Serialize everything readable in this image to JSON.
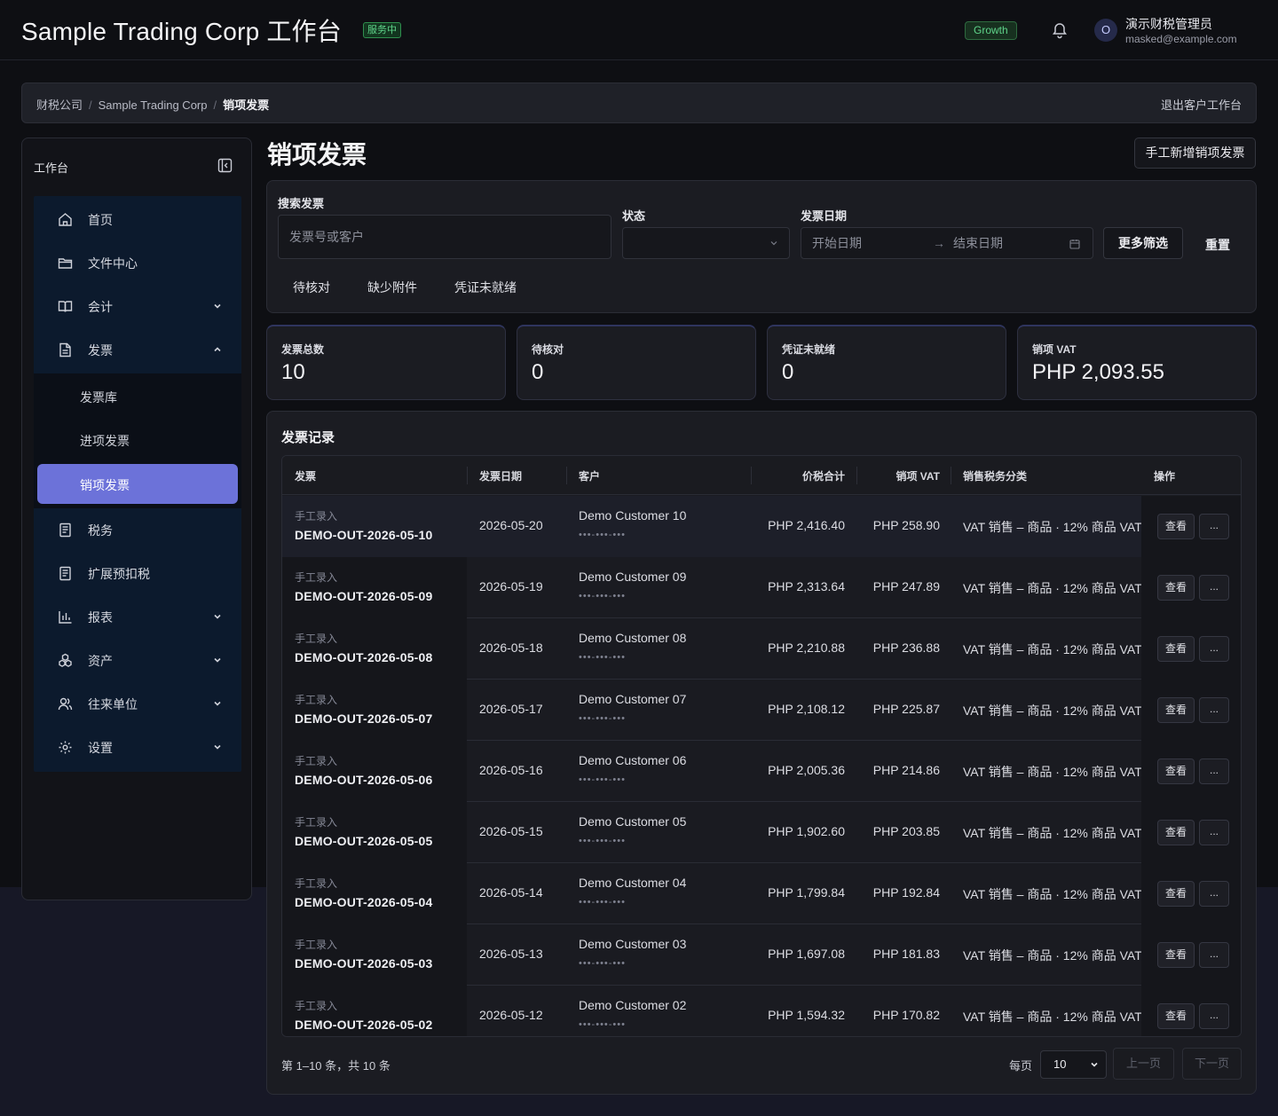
{
  "header": {
    "app_title": "Sample Trading Corp 工作台",
    "service_status": "服务中",
    "plan": "Growth",
    "user_initial": "O",
    "user_name": "演示财税管理员",
    "user_email": "masked@example.com"
  },
  "breadcrumb": {
    "items": [
      "财税公司",
      "Sample Trading Corp",
      "销项发票"
    ],
    "exit_label": "退出客户工作台"
  },
  "sidebar": {
    "title": "工作台",
    "items": [
      {
        "label": "首页",
        "icon": "home-icon"
      },
      {
        "label": "文件中心",
        "icon": "folder-icon"
      },
      {
        "label": "会计",
        "icon": "book-icon"
      },
      {
        "label": "发票",
        "icon": "document-icon"
      },
      {
        "label": "税务",
        "icon": "tax-icon"
      },
      {
        "label": "扩展预扣税",
        "icon": "withholding-icon"
      },
      {
        "label": "报表",
        "icon": "chart-icon"
      },
      {
        "label": "资产",
        "icon": "assets-icon"
      },
      {
        "label": "往来单位",
        "icon": "contacts-icon"
      },
      {
        "label": "设置",
        "icon": "gear-icon"
      }
    ],
    "invoice_sub": [
      "发票库",
      "进项发票",
      "销项发票"
    ]
  },
  "page": {
    "title": "销项发票",
    "new_button": "手工新增销项发票"
  },
  "filters": {
    "search_label": "搜索发票",
    "search_placeholder": "发票号或客户",
    "status_label": "状态",
    "status_value": "",
    "date_label": "发票日期",
    "start_placeholder": "开始日期",
    "end_placeholder": "结束日期",
    "arrow": "→",
    "more_button": "更多筛选",
    "reset_button": "重置",
    "quick_tabs": [
      "待核对",
      "缺少附件",
      "凭证未就绪"
    ]
  },
  "stats": [
    {
      "label": "发票总数",
      "value": "10"
    },
    {
      "label": "待核对",
      "value": "0"
    },
    {
      "label": "凭证未就绪",
      "value": "0"
    },
    {
      "label": "销项 VAT",
      "value": "PHP 2,093.55"
    }
  ],
  "records": {
    "title": "发票记录",
    "columns": [
      "发票",
      "发票日期",
      "客户",
      "价税合计",
      "销项 VAT",
      "销售税务分类",
      "操作"
    ],
    "rows": [
      {
        "source": "手工录入",
        "number": "DEMO-OUT-2026-05-10",
        "date": "2026-05-20",
        "customer": "Demo Customer 10",
        "tin": "•••-•••-•••",
        "total": "PHP 2,416.40",
        "vat": "PHP 258.90",
        "classification": "VAT 销售 – 商品 · 12% 商品 VAT",
        "view": "查看",
        "more": "..."
      },
      {
        "source": "手工录入",
        "number": "DEMO-OUT-2026-05-09",
        "date": "2026-05-19",
        "customer": "Demo Customer 09",
        "tin": "•••-•••-•••",
        "total": "PHP 2,313.64",
        "vat": "PHP 247.89",
        "classification": "VAT 销售 – 商品 · 12% 商品 VAT",
        "view": "查看",
        "more": "..."
      },
      {
        "source": "手工录入",
        "number": "DEMO-OUT-2026-05-08",
        "date": "2026-05-18",
        "customer": "Demo Customer 08",
        "tin": "•••-•••-•••",
        "total": "PHP 2,210.88",
        "vat": "PHP 236.88",
        "classification": "VAT 销售 – 商品 · 12% 商品 VAT",
        "view": "查看",
        "more": "..."
      },
      {
        "source": "手工录入",
        "number": "DEMO-OUT-2026-05-07",
        "date": "2026-05-17",
        "customer": "Demo Customer 07",
        "tin": "•••-•••-•••",
        "total": "PHP 2,108.12",
        "vat": "PHP 225.87",
        "classification": "VAT 销售 – 商品 · 12% 商品 VAT",
        "view": "查看",
        "more": "..."
      },
      {
        "source": "手工录入",
        "number": "DEMO-OUT-2026-05-06",
        "date": "2026-05-16",
        "customer": "Demo Customer 06",
        "tin": "•••-•••-•••",
        "total": "PHP 2,005.36",
        "vat": "PHP 214.86",
        "classification": "VAT 销售 – 商品 · 12% 商品 VAT",
        "view": "查看",
        "more": "..."
      },
      {
        "source": "手工录入",
        "number": "DEMO-OUT-2026-05-05",
        "date": "2026-05-15",
        "customer": "Demo Customer 05",
        "tin": "•••-•••-•••",
        "total": "PHP 1,902.60",
        "vat": "PHP 203.85",
        "classification": "VAT 销售 – 商品 · 12% 商品 VAT",
        "view": "查看",
        "more": "..."
      },
      {
        "source": "手工录入",
        "number": "DEMO-OUT-2026-05-04",
        "date": "2026-05-14",
        "customer": "Demo Customer 04",
        "tin": "•••-•••-•••",
        "total": "PHP 1,799.84",
        "vat": "PHP 192.84",
        "classification": "VAT 销售 – 商品 · 12% 商品 VAT",
        "view": "查看",
        "more": "..."
      },
      {
        "source": "手工录入",
        "number": "DEMO-OUT-2026-05-03",
        "date": "2026-05-13",
        "customer": "Demo Customer 03",
        "tin": "•••-•••-•••",
        "total": "PHP 1,697.08",
        "vat": "PHP 181.83",
        "classification": "VAT 销售 – 商品 · 12% 商品 VAT",
        "view": "查看",
        "more": "..."
      },
      {
        "source": "手工录入",
        "number": "DEMO-OUT-2026-05-02",
        "date": "2026-05-12",
        "customer": "Demo Customer 02",
        "tin": "•••-•••-•••",
        "total": "PHP 1,594.32",
        "vat": "PHP 170.82",
        "classification": "VAT 销售 – 商品 · 12% 商品 VAT",
        "view": "查看",
        "more": "..."
      }
    ]
  },
  "pagination": {
    "info": "第 1–10 条，共 10 条",
    "per_page_label": "每页",
    "per_page_value": "10",
    "prev": "上一页",
    "next": "下一页"
  }
}
